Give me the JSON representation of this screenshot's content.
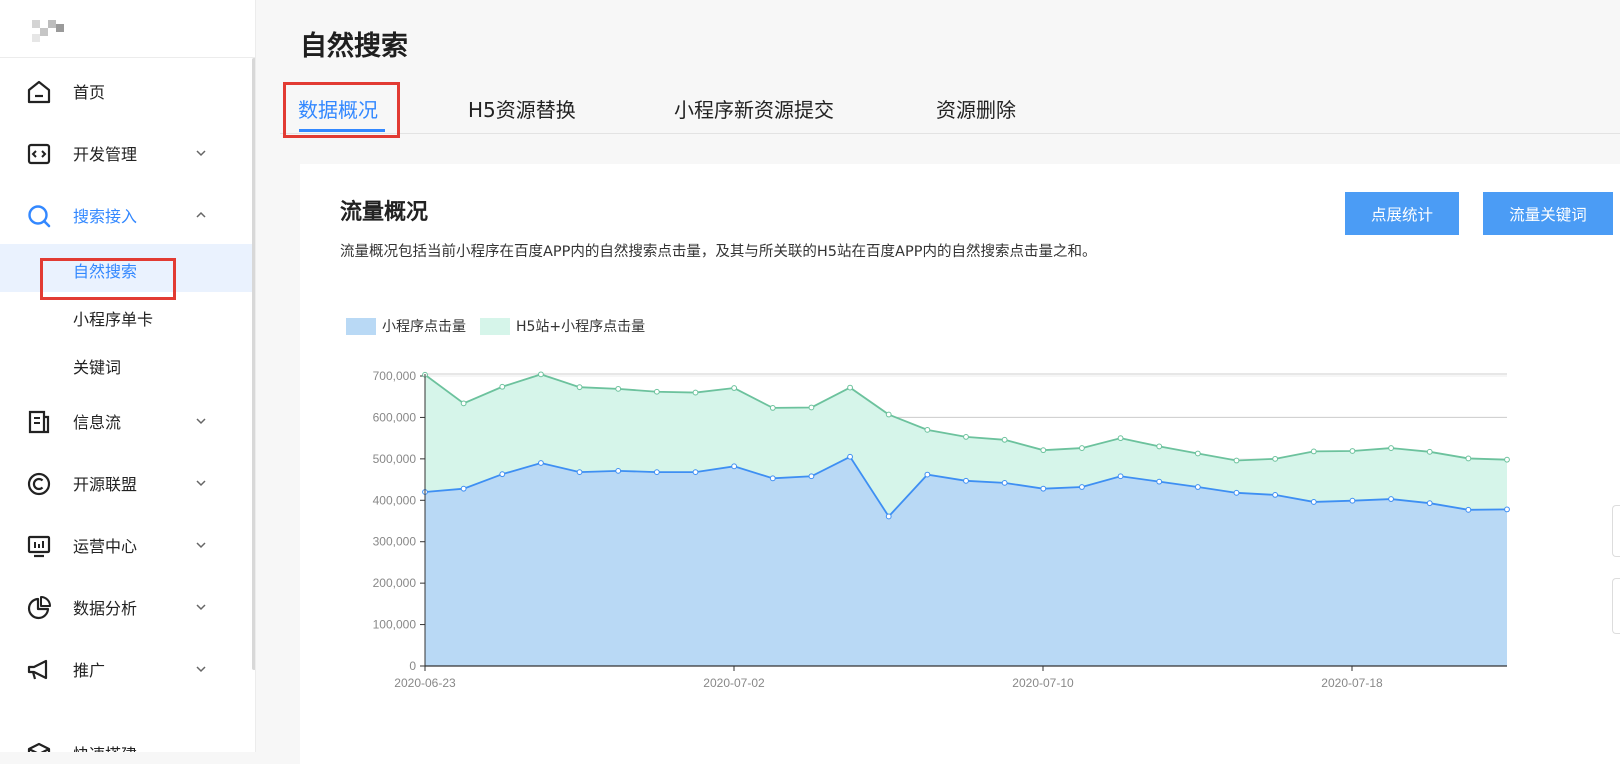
{
  "sidebar": {
    "items": [
      {
        "label": "首页",
        "icon": "home-icon"
      },
      {
        "label": "开发管理",
        "icon": "code-icon"
      },
      {
        "label": "搜索接入",
        "icon": "search-icon"
      },
      {
        "label": "信息流",
        "icon": "feed-icon"
      },
      {
        "label": "开源联盟",
        "icon": "copyright-icon"
      },
      {
        "label": "运营中心",
        "icon": "monitor-icon"
      },
      {
        "label": "数据分析",
        "icon": "pie-chart-icon"
      },
      {
        "label": "推广",
        "icon": "megaphone-icon"
      },
      {
        "label": "快速搭建",
        "icon": "cube-icon"
      }
    ],
    "sub_items": [
      {
        "label": "自然搜索"
      },
      {
        "label": "小程序单卡"
      },
      {
        "label": "关键词"
      }
    ]
  },
  "page": {
    "title": "自然搜索"
  },
  "tabs": [
    {
      "label": "数据概况"
    },
    {
      "label": "H5资源替换"
    },
    {
      "label": "小程序新资源提交"
    },
    {
      "label": "资源删除"
    }
  ],
  "card": {
    "title": "流量概况",
    "description": "流量概况包括当前小程序在百度APP内的自然搜索点击量，及其与所关联的H5站在百度APP内的自然搜索点击量之和。",
    "buttons": {
      "impression_stats": "点展统计",
      "traffic_keywords": "流量关键词"
    }
  },
  "colors": {
    "accent": "#3388ff",
    "highlight_box": "#e23b33",
    "series_blue_fill": "#b9d9f5",
    "series_blue_line": "#3e8ff3",
    "series_green_fill": "#d6f5ea",
    "series_green_line": "#6cc29d"
  },
  "chart_data": {
    "type": "area",
    "x_tick_labels": [
      "2020-06-23",
      "2020-07-02",
      "2020-07-10",
      "2020-07-18"
    ],
    "x_tick_index": [
      0,
      8,
      16,
      24
    ],
    "x": [
      "2020-06-23",
      "2020-06-24",
      "2020-06-25",
      "2020-06-26",
      "2020-06-27",
      "2020-06-28",
      "2020-06-29",
      "2020-06-30",
      "2020-07-01",
      "2020-07-02",
      "2020-07-03",
      "2020-07-04",
      "2020-07-05",
      "2020-07-06",
      "2020-07-07",
      "2020-07-08",
      "2020-07-09",
      "2020-07-10",
      "2020-07-11",
      "2020-07-12",
      "2020-07-13",
      "2020-07-14",
      "2020-07-15",
      "2020-07-16",
      "2020-07-17",
      "2020-07-18",
      "2020-07-19",
      "2020-07-20",
      "2020-07-21"
    ],
    "series": [
      {
        "name": "小程序点击量",
        "values": [
          420000,
          428000,
          463000,
          490000,
          468000,
          471000,
          468000,
          468000,
          482000,
          453000,
          458000,
          505000,
          361000,
          462000,
          447000,
          442000,
          428000,
          432000,
          458000,
          445000,
          432000,
          418000,
          413000,
          396000,
          399000,
          403000,
          393000,
          377000,
          378000
        ]
      },
      {
        "name": "H5站+小程序点击量",
        "values": [
          703000,
          634000,
          674000,
          704000,
          673000,
          669000,
          662000,
          660000,
          671000,
          623000,
          624000,
          672000,
          607000,
          570000,
          553000,
          546000,
          521000,
          526000,
          550000,
          530000,
          513000,
          496000,
          500000,
          518000,
          519000,
          526000,
          517000,
          501000,
          498000
        ]
      }
    ],
    "y_ticks": [
      "0",
      "100,000",
      "200,000",
      "300,000",
      "400,000",
      "500,000",
      "600,000",
      "700,000"
    ],
    "ylim": [
      0,
      700000
    ],
    "grid": true,
    "legend": "top-left"
  }
}
